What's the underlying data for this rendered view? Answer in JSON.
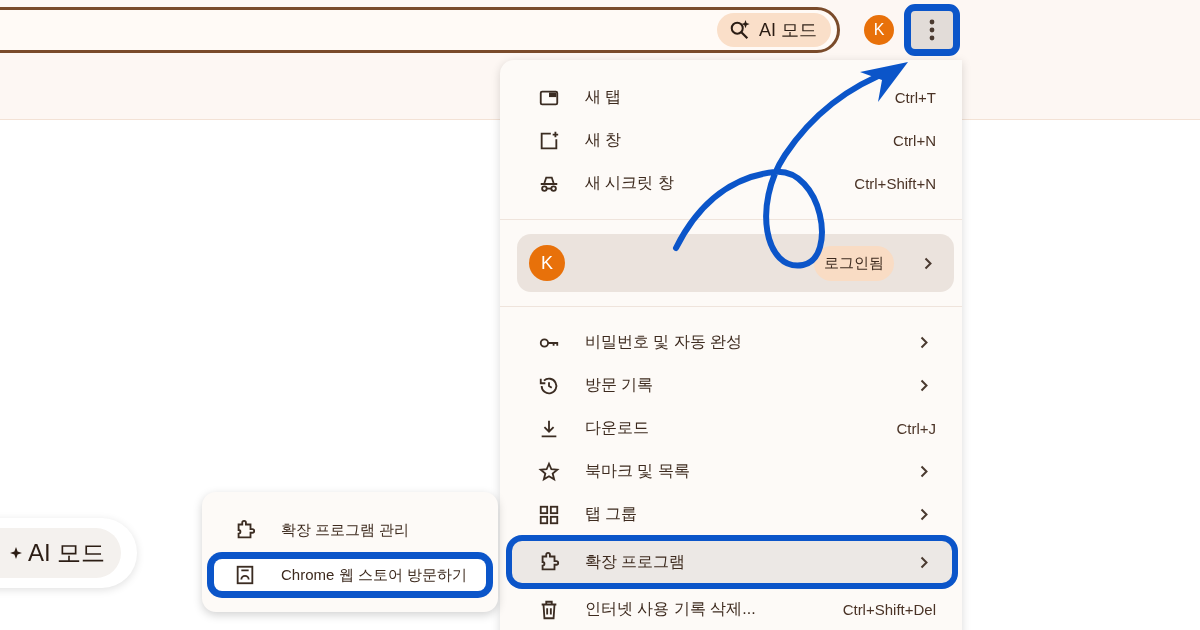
{
  "toolbar": {
    "ai_chip": "AI 모드",
    "avatar": "K",
    "menu_button_highlighted": true
  },
  "menu": {
    "groups": [
      {
        "kind": "items",
        "items": [
          {
            "label": "새 탭",
            "shortcut": "Ctrl+T",
            "submenu": false,
            "highlighted": false
          },
          {
            "label": "새 창",
            "shortcut": "Ctrl+N",
            "submenu": false,
            "highlighted": false
          },
          {
            "label": "새 시크릿 창",
            "shortcut": "Ctrl+Shift+N",
            "submenu": false,
            "highlighted": false
          }
        ]
      },
      {
        "kind": "profile",
        "avatar": "K",
        "status": "로그인됨",
        "submenu": true
      },
      {
        "kind": "items",
        "items": [
          {
            "label": "비밀번호 및 자동 완성",
            "submenu": true,
            "highlighted": false
          },
          {
            "label": "방문 기록",
            "submenu": true,
            "highlighted": false
          },
          {
            "label": "다운로드",
            "shortcut": "Ctrl+J",
            "submenu": false,
            "highlighted": false
          },
          {
            "label": "북마크 및 목록",
            "submenu": true,
            "highlighted": false
          },
          {
            "label": "탭 그룹",
            "submenu": true,
            "highlighted": false
          },
          {
            "label": "확장 프로그램",
            "submenu": true,
            "highlighted": true
          },
          {
            "label": "인터넷 사용 기록 삭제...",
            "shortcut": "Ctrl+Shift+Del",
            "submenu": false,
            "highlighted": false
          }
        ]
      }
    ]
  },
  "submenu": {
    "items": [
      {
        "label": "확장 프로그램 관리",
        "highlighted": false
      },
      {
        "label": "Chrome 웹 스토어 방문하기",
        "highlighted": true
      }
    ]
  },
  "page": {
    "ai_chip": "AI 모드"
  }
}
